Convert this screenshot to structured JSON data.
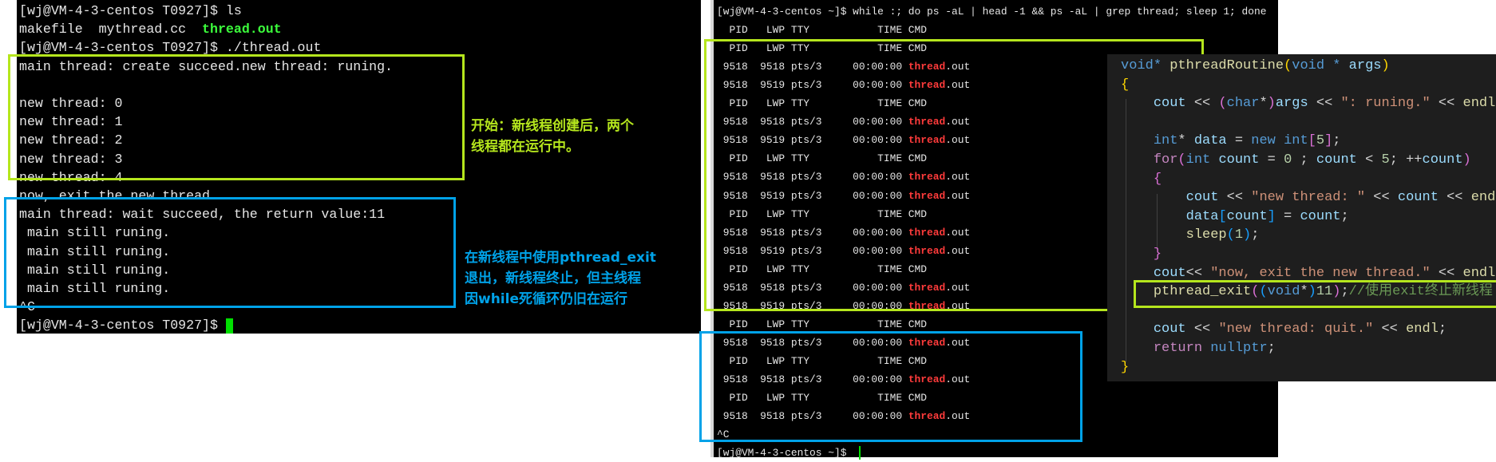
{
  "left_terminal": {
    "lines": [
      [
        {
          "t": "[wj@VM-4-3-centos T0927]$ ls"
        }
      ],
      [
        {
          "t": "makefile  mythread.cc  "
        },
        {
          "t": "thread.out",
          "s": "green"
        }
      ],
      [
        {
          "t": "[wj@VM-4-3-centos T0927]$ ./thread.out"
        }
      ],
      [
        {
          "t": "main thread: create succeed.new thread: runing."
        }
      ],
      [
        {
          "t": ""
        }
      ],
      [
        {
          "t": "new thread: 0"
        }
      ],
      [
        {
          "t": "new thread: 1"
        }
      ],
      [
        {
          "t": "new thread: 2"
        }
      ],
      [
        {
          "t": "new thread: 3"
        }
      ],
      [
        {
          "t": "new thread: 4"
        }
      ],
      [
        {
          "t": "now, exit the new thread."
        }
      ],
      [
        {
          "t": "main thread: wait succeed, the return value:11"
        }
      ],
      [
        {
          "t": " main still runing."
        }
      ],
      [
        {
          "t": " main still runing."
        }
      ],
      [
        {
          "t": " main still runing."
        }
      ],
      [
        {
          "t": " main still runing."
        }
      ],
      [
        {
          "t": "^C"
        }
      ],
      [
        {
          "t": "[wj@VM-4-3-centos T0927]$ "
        }
      ]
    ],
    "cursor_color": "#00e000"
  },
  "annotations": {
    "green_note": [
      "开始：新线程创建后，两个",
      "线程都在运行中。"
    ],
    "blue_note": [
      "在新线程中使用pthread_exit",
      "退出，新线程终止，但主线程",
      "因while死循环仍旧在运行"
    ],
    "green_color": "#b5e61d",
    "blue_color": "#00a2e8"
  },
  "right_terminal": {
    "lines": [
      [
        {
          "t": "[wj@VM-4-3-centos ~]$ while :; do ps -aL | head -1 && ps -aL | grep thread; sleep 1; done"
        }
      ],
      [
        {
          "t": "  PID   LWP TTY           TIME CMD"
        }
      ],
      [
        {
          "t": "  PID   LWP TTY           TIME CMD"
        }
      ],
      [
        {
          "t": " 9518  9518 pts/3     00:00:00 "
        },
        {
          "t": "thread",
          "s": "red"
        },
        {
          "t": ".out"
        }
      ],
      [
        {
          "t": " 9518  9519 pts/3     00:00:00 "
        },
        {
          "t": "thread",
          "s": "red"
        },
        {
          "t": ".out"
        }
      ],
      [
        {
          "t": "  PID   LWP TTY           TIME CMD"
        }
      ],
      [
        {
          "t": " 9518  9518 pts/3     00:00:00 "
        },
        {
          "t": "thread",
          "s": "red"
        },
        {
          "t": ".out"
        }
      ],
      [
        {
          "t": " 9518  9519 pts/3     00:00:00 "
        },
        {
          "t": "thread",
          "s": "red"
        },
        {
          "t": ".out"
        }
      ],
      [
        {
          "t": "  PID   LWP TTY           TIME CMD"
        }
      ],
      [
        {
          "t": " 9518  9518 pts/3     00:00:00 "
        },
        {
          "t": "thread",
          "s": "red"
        },
        {
          "t": ".out"
        }
      ],
      [
        {
          "t": " 9518  9519 pts/3     00:00:00 "
        },
        {
          "t": "thread",
          "s": "red"
        },
        {
          "t": ".out"
        }
      ],
      [
        {
          "t": "  PID   LWP TTY           TIME CMD"
        }
      ],
      [
        {
          "t": " 9518  9518 pts/3     00:00:00 "
        },
        {
          "t": "thread",
          "s": "red"
        },
        {
          "t": ".out"
        }
      ],
      [
        {
          "t": " 9518  9519 pts/3     00:00:00 "
        },
        {
          "t": "thread",
          "s": "red"
        },
        {
          "t": ".out"
        }
      ],
      [
        {
          "t": "  PID   LWP TTY           TIME CMD"
        }
      ],
      [
        {
          "t": " 9518  9518 pts/3     00:00:00 "
        },
        {
          "t": "thread",
          "s": "red"
        },
        {
          "t": ".out"
        }
      ],
      [
        {
          "t": " 9518  9519 pts/3     00:00:00 "
        },
        {
          "t": "thread",
          "s": "red"
        },
        {
          "t": ".out"
        }
      ],
      [
        {
          "t": "  PID   LWP TTY           TIME CMD"
        }
      ],
      [
        {
          "t": " 9518  9518 pts/3     00:00:00 "
        },
        {
          "t": "thread",
          "s": "red"
        },
        {
          "t": ".out"
        }
      ],
      [
        {
          "t": "  PID   LWP TTY           TIME CMD"
        }
      ],
      [
        {
          "t": " 9518  9518 pts/3     00:00:00 "
        },
        {
          "t": "thread",
          "s": "red"
        },
        {
          "t": ".out"
        }
      ],
      [
        {
          "t": "  PID   LWP TTY           TIME CMD"
        }
      ],
      [
        {
          "t": " 9518  9518 pts/3     00:00:00 "
        },
        {
          "t": "thread",
          "s": "red"
        },
        {
          "t": ".out"
        }
      ],
      [
        {
          "t": "^C"
        }
      ],
      [
        {
          "t": "[wj@VM-4-3-centos ~]$ "
        }
      ]
    ]
  },
  "code": {
    "lines": [
      [
        {
          "t": "void",
          "c": "#569cd6"
        },
        {
          "t": "* ",
          "c": "#569cd6"
        },
        {
          "t": "pthreadRoutine",
          "c": "#dcdcaa"
        },
        {
          "t": "(",
          "c": "#ffd700"
        },
        {
          "t": "void",
          "c": "#569cd6"
        },
        {
          "t": " * ",
          "c": "#569cd6"
        },
        {
          "t": "args",
          "c": "#9cdcfe"
        },
        {
          "t": ")",
          "c": "#ffd700"
        }
      ],
      [
        {
          "t": "{",
          "c": "#ffd700"
        }
      ],
      [
        {
          "t": "    "
        },
        {
          "t": "cout",
          "c": "#9cdcfe"
        },
        {
          "t": " << "
        },
        {
          "t": "(",
          "c": "#da70d6"
        },
        {
          "t": "char",
          "c": "#569cd6"
        },
        {
          "t": "*"
        },
        {
          "t": ")",
          "c": "#da70d6"
        },
        {
          "t": "args",
          "c": "#9cdcfe"
        },
        {
          "t": " << "
        },
        {
          "t": "\": runing.\"",
          "c": "#ce9178"
        },
        {
          "t": " << "
        },
        {
          "t": "endl",
          "c": "#dcdcaa"
        },
        {
          "t": ";"
        }
      ],
      [
        {
          "t": ""
        }
      ],
      [
        {
          "t": "    "
        },
        {
          "t": "int",
          "c": "#569cd6"
        },
        {
          "t": "* "
        },
        {
          "t": "data",
          "c": "#9cdcfe"
        },
        {
          "t": " = "
        },
        {
          "t": "new",
          "c": "#569cd6"
        },
        {
          "t": " "
        },
        {
          "t": "int",
          "c": "#569cd6"
        },
        {
          "t": "[",
          "c": "#da70d6"
        },
        {
          "t": "5",
          "c": "#b5cea8"
        },
        {
          "t": "]",
          "c": "#da70d6"
        },
        {
          "t": ";"
        }
      ],
      [
        {
          "t": "    "
        },
        {
          "t": "for",
          "c": "#c586c0"
        },
        {
          "t": "(",
          "c": "#da70d6"
        },
        {
          "t": "int",
          "c": "#569cd6"
        },
        {
          "t": " "
        },
        {
          "t": "count",
          "c": "#9cdcfe"
        },
        {
          "t": " = "
        },
        {
          "t": "0",
          "c": "#b5cea8"
        },
        {
          "t": " ; "
        },
        {
          "t": "count",
          "c": "#9cdcfe"
        },
        {
          "t": " < "
        },
        {
          "t": "5",
          "c": "#b5cea8"
        },
        {
          "t": "; ++"
        },
        {
          "t": "count",
          "c": "#9cdcfe"
        },
        {
          "t": ")",
          "c": "#da70d6"
        }
      ],
      [
        {
          "t": "    "
        },
        {
          "t": "{",
          "c": "#da70d6"
        }
      ],
      [
        {
          "t": "        "
        },
        {
          "t": "cout",
          "c": "#9cdcfe"
        },
        {
          "t": " << "
        },
        {
          "t": "\"new thread: \"",
          "c": "#ce9178"
        },
        {
          "t": " << "
        },
        {
          "t": "count",
          "c": "#9cdcfe"
        },
        {
          "t": " << "
        },
        {
          "t": "endl",
          "c": "#dcdcaa"
        },
        {
          "t": ";"
        }
      ],
      [
        {
          "t": "        "
        },
        {
          "t": "data",
          "c": "#9cdcfe"
        },
        {
          "t": "[",
          "c": "#179fff"
        },
        {
          "t": "count",
          "c": "#9cdcfe"
        },
        {
          "t": "]",
          "c": "#179fff"
        },
        {
          "t": " = "
        },
        {
          "t": "count",
          "c": "#9cdcfe"
        },
        {
          "t": ";"
        }
      ],
      [
        {
          "t": "        "
        },
        {
          "t": "sleep",
          "c": "#dcdcaa"
        },
        {
          "t": "(",
          "c": "#179fff"
        },
        {
          "t": "1",
          "c": "#b5cea8"
        },
        {
          "t": ")",
          "c": "#179fff"
        },
        {
          "t": ";"
        }
      ],
      [
        {
          "t": "    "
        },
        {
          "t": "}",
          "c": "#da70d6"
        }
      ],
      [
        {
          "t": "    "
        },
        {
          "t": "cout",
          "c": "#9cdcfe"
        },
        {
          "t": "<< "
        },
        {
          "t": "\"now, exit the new thread.\"",
          "c": "#ce9178"
        },
        {
          "t": " << "
        },
        {
          "t": "endl",
          "c": "#dcdcaa"
        },
        {
          "t": ";"
        }
      ],
      [
        {
          "t": "    "
        },
        {
          "t": "pthread_exit",
          "c": "#dcdcaa"
        },
        {
          "t": "(",
          "c": "#da70d6"
        },
        {
          "t": "(",
          "c": "#179fff"
        },
        {
          "t": "void",
          "c": "#569cd6"
        },
        {
          "t": "*"
        },
        {
          "t": ")",
          "c": "#179fff"
        },
        {
          "t": "11",
          "c": "#b5cea8"
        },
        {
          "t": ")",
          "c": "#da70d6"
        },
        {
          "t": ";"
        },
        {
          "t": "//使用exit终止新线程",
          "c": "#6a9955"
        }
      ],
      [
        {
          "t": ""
        }
      ],
      [
        {
          "t": "    "
        },
        {
          "t": "cout",
          "c": "#9cdcfe"
        },
        {
          "t": " << "
        },
        {
          "t": "\"new thread: quit.\"",
          "c": "#ce9178"
        },
        {
          "t": " << "
        },
        {
          "t": "endl",
          "c": "#dcdcaa"
        },
        {
          "t": ";"
        }
      ],
      [
        {
          "t": "    "
        },
        {
          "t": "return",
          "c": "#c586c0"
        },
        {
          "t": " "
        },
        {
          "t": "nullptr",
          "c": "#569cd6"
        },
        {
          "t": ";"
        }
      ],
      [
        {
          "t": "}",
          "c": "#ffd700"
        }
      ]
    ],
    "background": "#1e1e1e"
  }
}
